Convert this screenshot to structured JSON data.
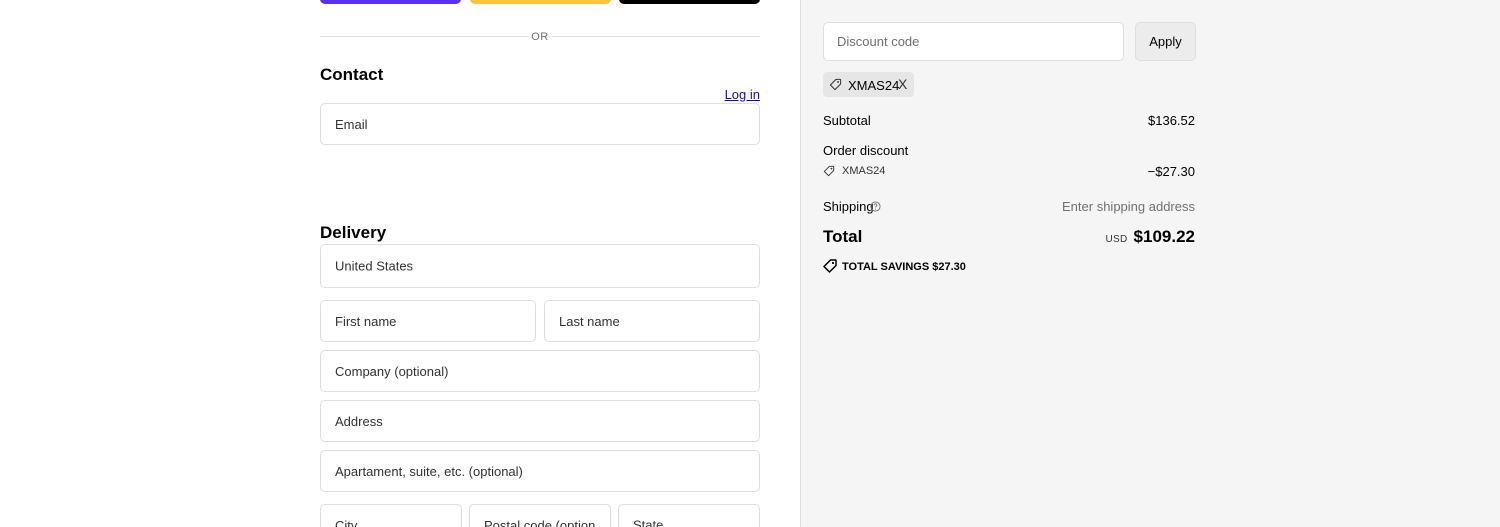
{
  "express": {
    "shop_color": "#5a31f4",
    "paypal_color": "#ffc439",
    "gpay_color": "#000000",
    "divider_text": "OR"
  },
  "contact": {
    "heading": "Contact",
    "login_link": "Log in",
    "email_placeholder": "Email"
  },
  "delivery": {
    "heading": "Delivery",
    "country": "United States",
    "first_name_placeholder": "First name",
    "last_name_placeholder": "Last name",
    "company_placeholder": "Company (optional)",
    "address_placeholder": "Address",
    "apartment_placeholder": "Apartament, suite, etc. (optional)",
    "city_placeholder": "City",
    "postal_placeholder": "Postal code (optional)",
    "state_placeholder": "State"
  },
  "summary": {
    "discount_placeholder": "Discount code",
    "apply_label": "Apply",
    "applied_code": "XMAS24",
    "remove_label": "X",
    "subtotal_label": "Subtotal",
    "subtotal_value": "$136.52",
    "order_discount_label": "Order discount",
    "discount_code": "XMAS24",
    "discount_value": "−$27.30",
    "shipping_label": "Shipping",
    "shipping_value": "Enter shipping address",
    "total_label": "Total",
    "currency": "USD",
    "total_value": "$109.22",
    "savings_text": "TOTAL SAVINGS $27.30",
    "icons": [
      "tag-icon",
      "help-circle-icon",
      "savings-tag-icon"
    ]
  }
}
